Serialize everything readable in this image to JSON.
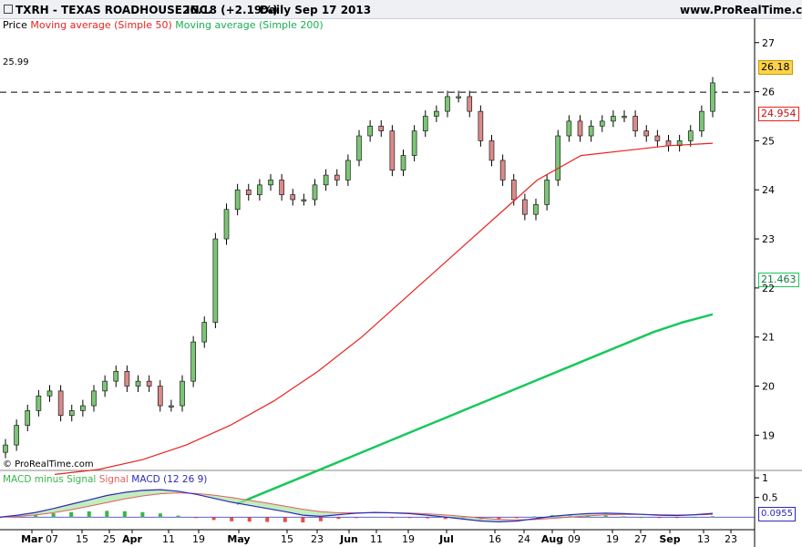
{
  "header": {
    "instrument": "TXRH - TEXAS ROADHOUSE INC.",
    "quote": "26.18 (+2.19%)",
    "interval_date": "Daily  Sep 17 2013",
    "site": "www.ProRealTime.com"
  },
  "legend": {
    "price": "Price",
    "ma50": "Moving average (Simple 50)",
    "ma200": "Moving average (Simple 200)"
  },
  "macd_legend": {
    "hist": "MACD minus Signal",
    "signal": "Signal",
    "macd": "MACD (12 26 9)"
  },
  "watermark": "© ProRealTime.com",
  "colors": {
    "up": "#7cc576",
    "down": "#d98b8b",
    "wick": "#000000",
    "ma50": "#e8231f",
    "ma200": "#17c85a",
    "macd": "#2b2bb8",
    "signal": "#e06060",
    "fill_up": "#a8e6a3",
    "fill_down": "#f2b4b4",
    "hist": "#39b54a",
    "current_box": "#ffd24a"
  },
  "chart_data": {
    "type": "candlestick",
    "period": "Daily",
    "y_ticks": [
      19,
      20,
      21,
      22,
      23,
      24,
      25,
      26,
      27
    ],
    "ylim": [
      18.3,
      27.2
    ],
    "reference_line": {
      "label": "25.99",
      "value": 25.99
    },
    "last_price": "26.18",
    "ma50_last": "24.954",
    "ma200_last": "21.463",
    "x_tick_labels": [
      "Mar",
      "07",
      "15",
      "25",
      "Apr",
      "11",
      "19",
      "May",
      "15",
      "23",
      "Jun",
      "11",
      "19",
      "Jul",
      "16",
      "24",
      "Aug",
      "09",
      "19",
      "27",
      "Sep",
      "13",
      "23"
    ],
    "macd_ticks": [
      "1",
      "0.5"
    ],
    "macd_last": "0.0955",
    "ma50_series": [
      18.2,
      18.3,
      18.5,
      18.8,
      19.2,
      19.7,
      20.3,
      21.0,
      21.8,
      22.6,
      23.4,
      24.2,
      24.7,
      24.8,
      24.9,
      24.95
    ],
    "ma200_series": [
      17.6,
      17.85,
      18.1,
      18.35,
      18.6,
      18.85,
      19.1,
      19.35,
      19.6,
      19.85,
      20.1,
      20.35,
      20.6,
      20.85,
      21.1,
      21.3,
      21.463
    ],
    "close_series": [
      18.8,
      19.2,
      19.5,
      19.8,
      19.9,
      19.4,
      19.5,
      19.6,
      19.9,
      20.1,
      20.3,
      20.0,
      20.1,
      20.0,
      19.6,
      19.6,
      20.1,
      20.9,
      21.3,
      23.0,
      23.6,
      24.0,
      23.9,
      24.1,
      24.2,
      23.9,
      23.8,
      23.8,
      24.1,
      24.3,
      24.2,
      24.6,
      25.1,
      25.3,
      25.2,
      24.4,
      24.7,
      25.2,
      25.5,
      25.6,
      25.9,
      25.9,
      25.6,
      25.0,
      24.6,
      24.2,
      23.8,
      23.5,
      23.7,
      24.2,
      25.1,
      25.4,
      25.1,
      25.3,
      25.4,
      25.5,
      25.5,
      25.2,
      25.1,
      25.0,
      24.9,
      25.0,
      25.2,
      25.6,
      26.18
    ],
    "macd_series": [
      0.0,
      0.05,
      0.12,
      0.22,
      0.33,
      0.44,
      0.55,
      0.63,
      0.68,
      0.7,
      0.66,
      0.58,
      0.48,
      0.38,
      0.3,
      0.22,
      0.14,
      0.05,
      0.02,
      0.06,
      0.1,
      0.12,
      0.11,
      0.09,
      0.05,
      0.0,
      -0.05,
      -0.1,
      -0.12,
      -0.1,
      -0.04,
      0.02,
      0.06,
      0.09,
      0.1,
      0.09,
      0.07,
      0.05,
      0.04,
      0.06,
      0.0955
    ]
  }
}
